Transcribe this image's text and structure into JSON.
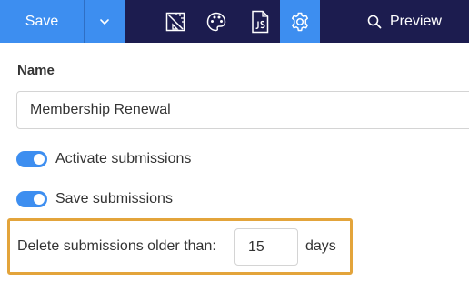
{
  "toolbar": {
    "save_label": "Save",
    "preview_label": "Preview",
    "icons": [
      "save-options-chevron",
      "layout-ruler",
      "theme-palette",
      "javascript-file",
      "settings-gear",
      "search"
    ],
    "colors": {
      "toolbar_bg": "#1c1c4f",
      "accent": "#3d8ef0"
    }
  },
  "form": {
    "name_label": "Name",
    "name_value": "Membership Renewal",
    "activate_label": "Activate submissions",
    "activate_on": true,
    "save_label": "Save submissions",
    "save_on": true,
    "delete_label": "Delete submissions older than:",
    "delete_days": "15",
    "days_unit": "days",
    "highlight_color": "#e3a43b"
  }
}
